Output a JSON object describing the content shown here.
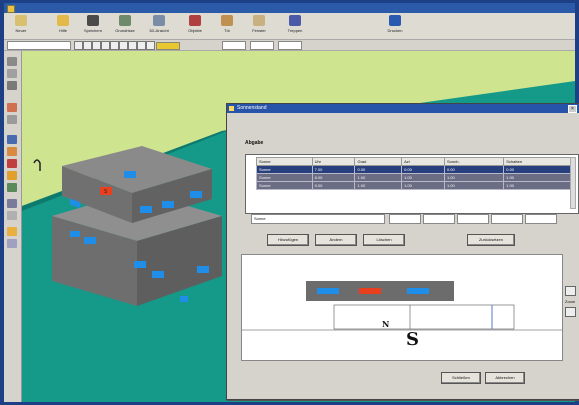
{
  "app": {
    "title": ""
  },
  "toolbar": {
    "buttons": [
      {
        "label": "Neuer",
        "icon": "new-icon",
        "color": "#d8c070"
      },
      {
        "label": "Hilfe",
        "icon": "help-icon",
        "color": "#e3b94a"
      },
      {
        "label": "Speichern",
        "icon": "save-icon",
        "color": "#4a4a4a"
      },
      {
        "label": "Grundrisse",
        "icon": "floorplan-icon",
        "color": "#6f8a6a"
      },
      {
        "label": "3D-Ansicht",
        "icon": "3d-view-icon",
        "color": "#7a8ca6"
      },
      {
        "label": "Objekte",
        "icon": "objects-icon",
        "color": "#b04040"
      },
      {
        "label": "Tür",
        "icon": "door-icon",
        "color": "#c09050"
      },
      {
        "label": "Fenster",
        "icon": "window-icon",
        "color": "#c8b080"
      },
      {
        "label": "Treppen",
        "icon": "stairs-icon",
        "color": "#4a5aa8"
      },
      {
        "label": "Drucken",
        "icon": "print-icon",
        "color": "#2a5ab0"
      }
    ]
  },
  "options": {
    "combo1": "",
    "combo2": "",
    "combo3": "",
    "combo4": ""
  },
  "dialog": {
    "title": "Sonnenstand",
    "section": "Abgabe",
    "columns": [
      "Sonne",
      "Uhr",
      "Grad",
      "Azi",
      "Sonnh.",
      "Schatten"
    ],
    "rows": [
      {
        "cells": [
          "Sonne",
          "7.00",
          "0.00",
          "0.00",
          "0.00",
          "0.00"
        ],
        "selected": true
      },
      {
        "cells": [
          "Sonne",
          "8.00",
          "1.00",
          "1.00",
          "1.00",
          "1.00"
        ],
        "selected": false
      },
      {
        "cells": [
          "Sonne",
          "9.00",
          "1.00",
          "1.00",
          "1.00",
          "1.00"
        ],
        "selected": false
      }
    ],
    "field_value": "Sonne",
    "buttons": {
      "add": "Hinzufügen",
      "change": "Ändern",
      "delete": "Löschen",
      "reset": "Zurücksetzen"
    },
    "preview": {
      "north_label": "N",
      "south_label": "S"
    },
    "side_label": "Zoom",
    "ok_label": "Schließen",
    "cancel_label": "Abbrechen"
  },
  "scene": {
    "sun_marker": "S"
  },
  "colors": {
    "titlebar": "#2a5aa8",
    "selection": "#27407d",
    "ground": "#159a8a",
    "building": "#7a7a7a",
    "window_blue": "#1f8ee8",
    "window_red": "#e8401f"
  }
}
